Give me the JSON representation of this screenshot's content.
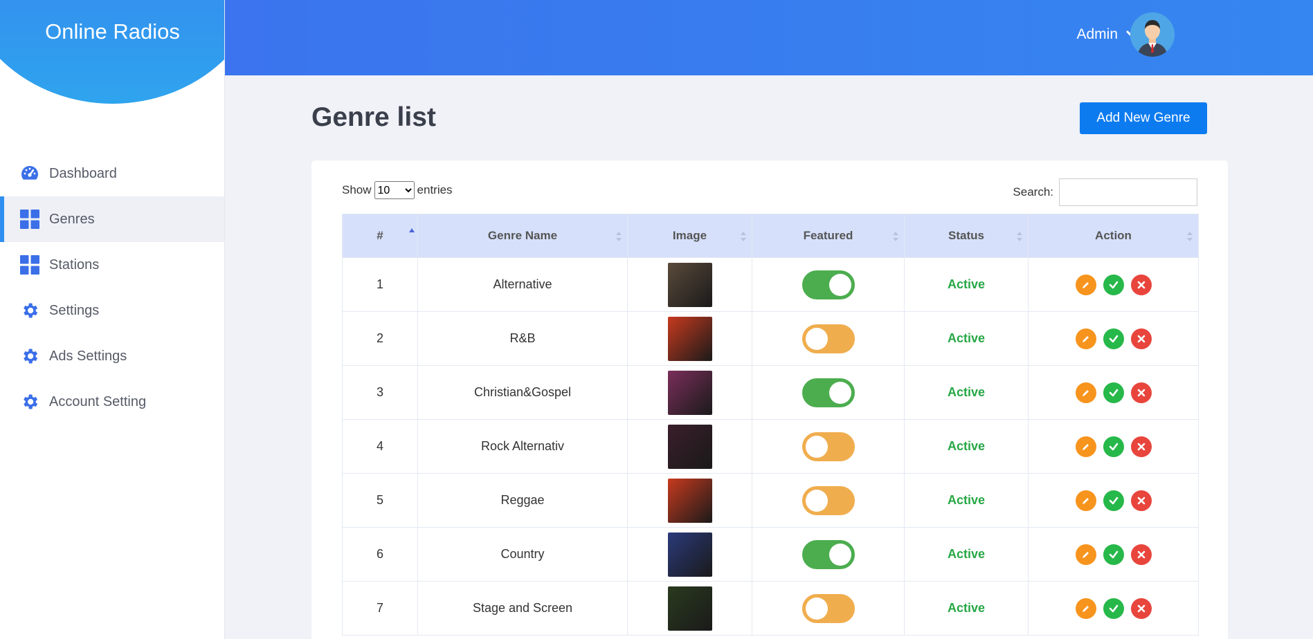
{
  "app": {
    "title": "Online Radios"
  },
  "sidebar": {
    "items": [
      {
        "label": "Dashboard",
        "icon": "dashboard-icon",
        "active": false
      },
      {
        "label": "Genres",
        "icon": "grid-icon",
        "active": true
      },
      {
        "label": "Stations",
        "icon": "grid-icon",
        "active": false
      },
      {
        "label": "Settings",
        "icon": "gear-icon",
        "active": false
      },
      {
        "label": "Ads Settings",
        "icon": "gear-icon",
        "active": false
      },
      {
        "label": "Account Setting",
        "icon": "gear-icon",
        "active": false
      }
    ]
  },
  "header": {
    "user_label": "Admin"
  },
  "main": {
    "title": "Genre list",
    "add_button": "Add New Genre",
    "show_label": "Show",
    "entries_label": "entries",
    "entries_selected": "10",
    "search_label": "Search:",
    "search_value": "",
    "columns": [
      "#",
      "Genre Name",
      "Image",
      "Featured",
      "Status",
      "Action"
    ],
    "rows": [
      {
        "num": "1",
        "name": "Alternative",
        "featured": true,
        "status": "Active",
        "thumb": "#5a4a3a"
      },
      {
        "num": "2",
        "name": "R&B",
        "featured": false,
        "status": "Active",
        "thumb": "#c73a1e"
      },
      {
        "num": "3",
        "name": "Christian&Gospel",
        "featured": true,
        "status": "Active",
        "thumb": "#7a2e5a"
      },
      {
        "num": "4",
        "name": "Rock Alternativ",
        "featured": false,
        "status": "Active",
        "thumb": "#3a1e2a"
      },
      {
        "num": "5",
        "name": "Reggae",
        "featured": false,
        "status": "Active",
        "thumb": "#c73a1e"
      },
      {
        "num": "6",
        "name": "Country",
        "featured": true,
        "status": "Active",
        "thumb": "#2a3a7a"
      },
      {
        "num": "7",
        "name": "Stage and Screen",
        "featured": false,
        "status": "Active",
        "thumb": "#2a3a1e"
      }
    ]
  },
  "colors": {
    "accent": "#3b74ee",
    "featured_on": "#4cad4f",
    "featured_off": "#f0ad4e",
    "status_active": "#27a745",
    "edit": "#f7941d",
    "approve": "#27b84a",
    "delete": "#e8453c"
  }
}
